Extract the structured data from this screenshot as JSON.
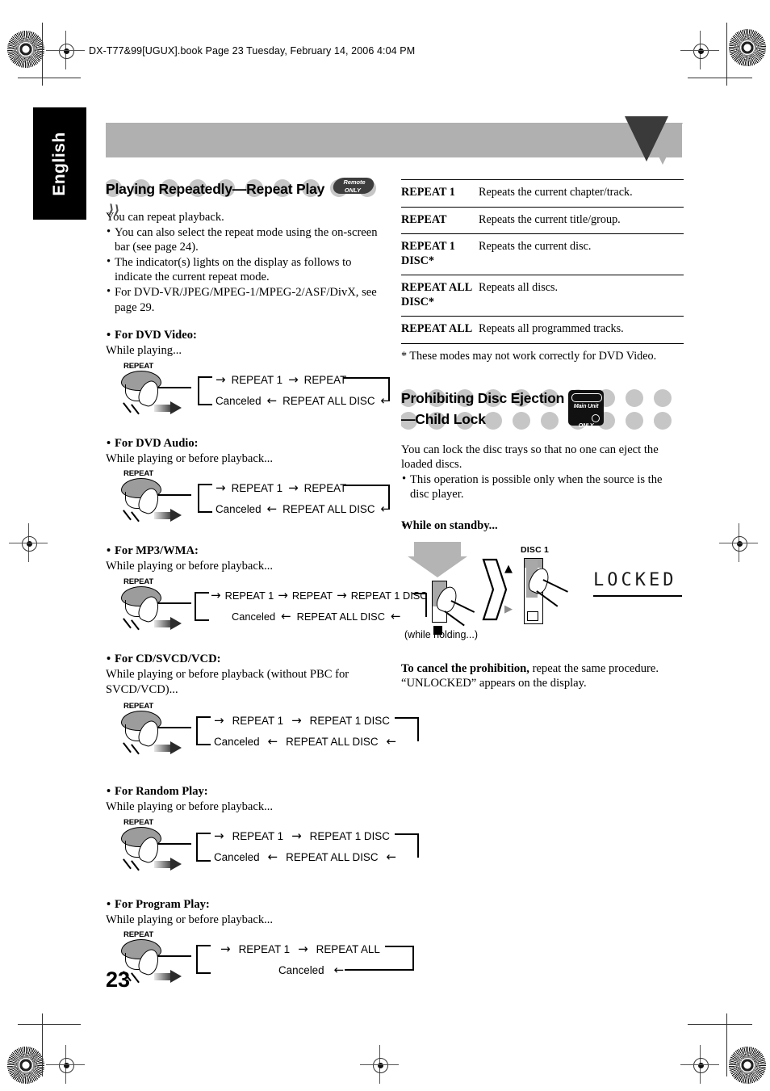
{
  "print": {
    "book_line": "DX-T77&99[UGUX].book  Page 23  Tuesday, February 14, 2006  4:04 PM"
  },
  "lang_tab": {
    "label": "English"
  },
  "page_number": "23",
  "left_column": {
    "heading": "Playing Repeatedly—Repeat Play",
    "heading_badge": {
      "line1": "Remote",
      "line2": "ONLY"
    },
    "intro": "You can repeat playback.",
    "bullets": [
      "You can also select the repeat mode using the on-screen bar (see page 24).",
      "The indicator(s) lights on the display as follows to indicate the current repeat mode.",
      "For DVD-VR/JPEG/MPEG-1/MPEG-2/ASF/DivX, see page 29."
    ],
    "sections": [
      {
        "title": "For DVD Video:",
        "cue": "While playing...",
        "button_label": "REPEAT",
        "row_top": [
          "REPEAT 1",
          "REPEAT"
        ],
        "row_bottom": [
          "Canceled",
          "REPEAT ALL DISC"
        ]
      },
      {
        "title": "For DVD Audio:",
        "cue": "While playing or before playback...",
        "button_label": "REPEAT",
        "row_top": [
          "REPEAT 1",
          "REPEAT"
        ],
        "row_bottom": [
          "Canceled",
          "REPEAT ALL DISC"
        ]
      },
      {
        "title": "For MP3/WMA:",
        "cue": "While playing or before playback...",
        "button_label": "REPEAT",
        "row_top": [
          "REPEAT 1",
          "REPEAT",
          "REPEAT 1 DISC"
        ],
        "row_bottom": [
          "Canceled",
          "REPEAT ALL DISC"
        ]
      },
      {
        "title": "For CD/SVCD/VCD:",
        "cue": "While playing or before playback (without PBC for SVCD/VCD)...",
        "button_label": "REPEAT",
        "row_top": [
          "REPEAT 1",
          "REPEAT 1 DISC"
        ],
        "row_bottom": [
          "Canceled",
          "REPEAT ALL DISC"
        ]
      },
      {
        "title": "For Random Play:",
        "cue": "While playing or before playback...",
        "button_label": "REPEAT",
        "row_top": [
          "REPEAT 1",
          "REPEAT 1 DISC"
        ],
        "row_bottom": [
          "Canceled",
          "REPEAT ALL DISC"
        ]
      },
      {
        "title": "For Program Play:",
        "cue": "While playing or before playback...",
        "button_label": "REPEAT",
        "row_top": [
          "REPEAT 1",
          "REPEAT ALL"
        ],
        "row_bottom": [
          "Canceled"
        ]
      }
    ]
  },
  "right_column": {
    "table": {
      "rows": [
        {
          "mode": "REPEAT 1",
          "desc": "Repeats the current chapter/track."
        },
        {
          "mode": "REPEAT",
          "desc": "Repeats the current title/group."
        },
        {
          "mode": "REPEAT 1 DISC*",
          "desc": "Repeats the current disc."
        },
        {
          "mode": "REPEAT ALL DISC*",
          "desc": "Repeats all discs."
        },
        {
          "mode": "REPEAT ALL",
          "desc": "Repeats all programmed tracks."
        }
      ],
      "footnote": "* These modes may not work correctly for DVD Video."
    },
    "heading_line1": "Prohibiting Disc Ejection",
    "heading_line2": "—Child Lock",
    "heading_badge": {
      "line1": "Main Unit",
      "line2": "ONLY"
    },
    "intro": "You can lock the disc trays so that no one can eject the loaded discs.",
    "bullets": [
      "This operation is possible only when the source is the disc player."
    ],
    "standby_head": "While on standby...",
    "figure": {
      "hold_caption": "(while holding...)",
      "disc_label": "DISC 1",
      "lcd_text": "LOCKED"
    },
    "cancel_bold": "To cancel the prohibition,",
    "cancel_rest": " repeat the same procedure. “UNLOCKED” appears on the display."
  }
}
